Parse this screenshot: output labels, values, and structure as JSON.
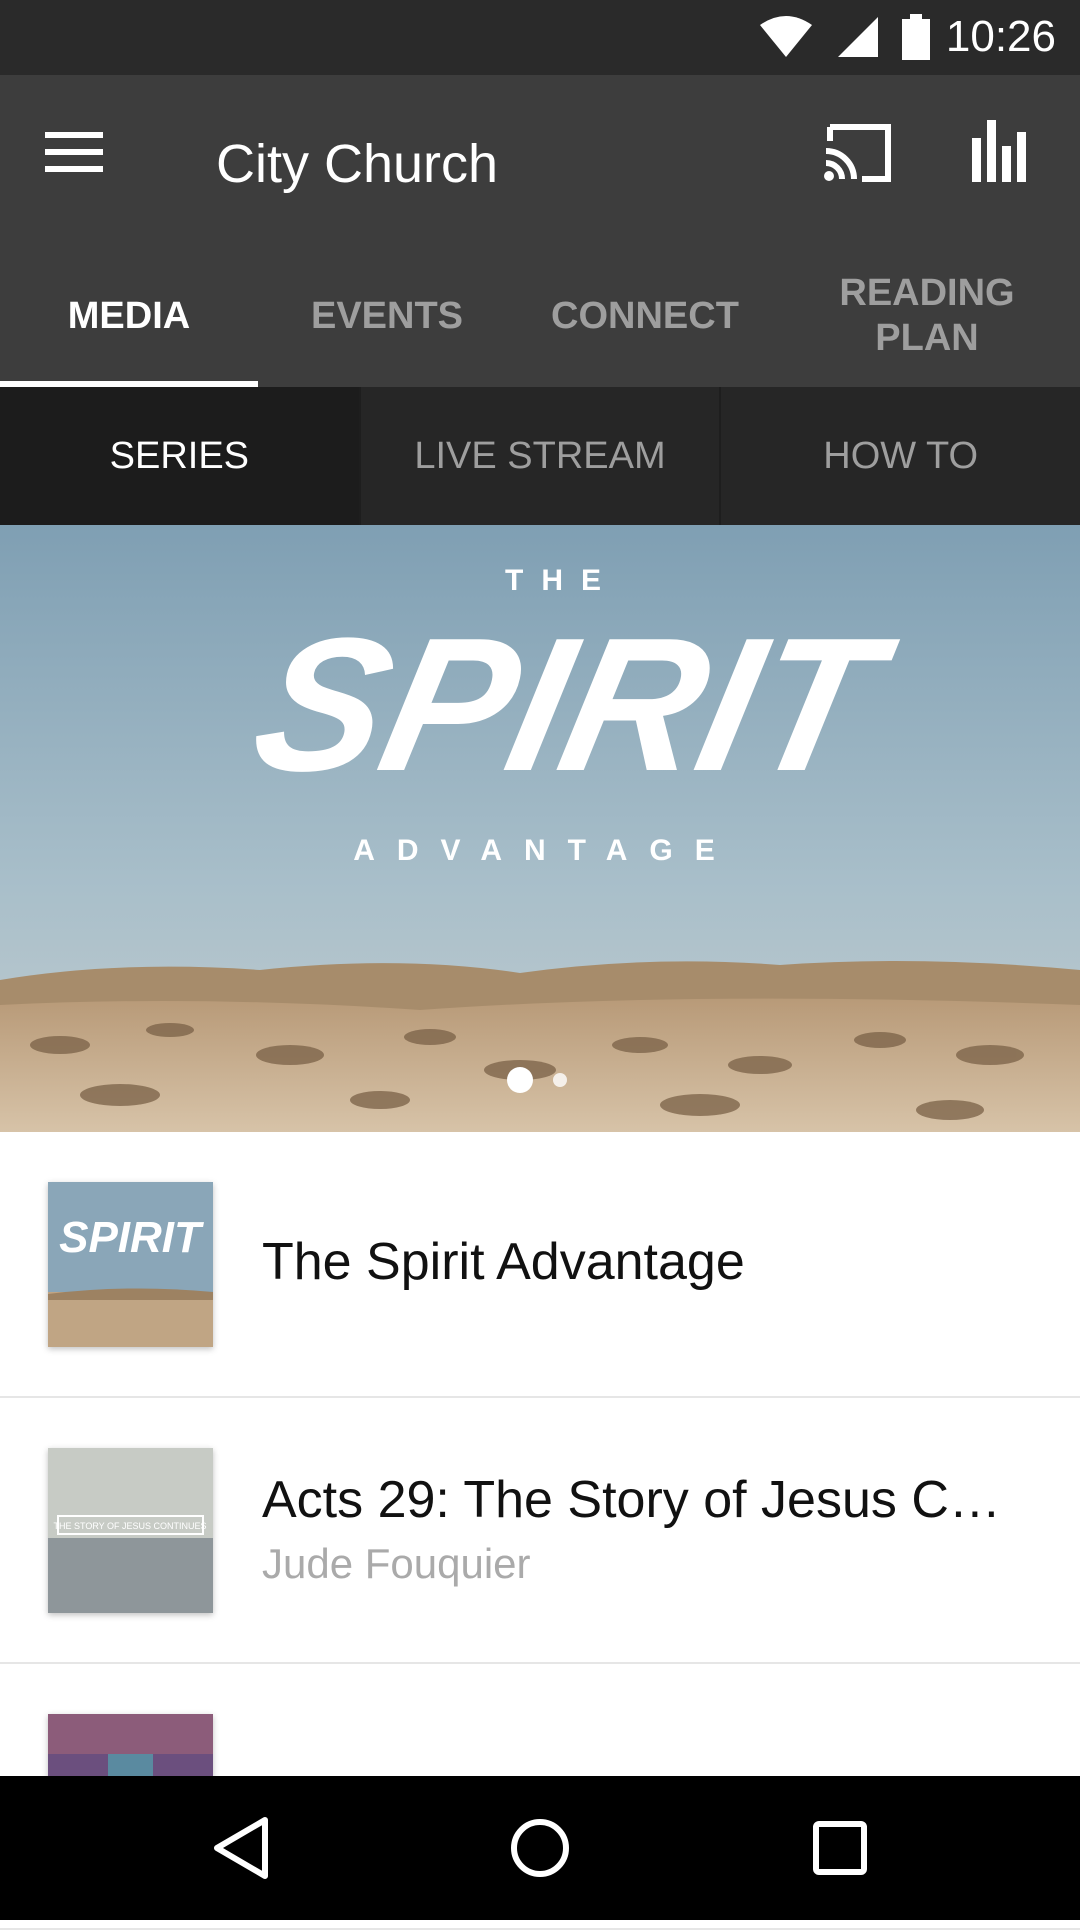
{
  "status": {
    "time": "10:26",
    "icons": [
      "wifi-icon",
      "signal-icon",
      "battery-icon"
    ]
  },
  "appbar": {
    "title": "City Church",
    "icons": [
      "menu-icon",
      "cast-icon",
      "stats-icon"
    ]
  },
  "tabs": [
    {
      "label": "MEDIA",
      "active": true
    },
    {
      "label": "EVENTS",
      "active": false
    },
    {
      "label": "CONNECT",
      "active": false
    },
    {
      "label": "READING PLAN",
      "active": false
    }
  ],
  "subtabs": [
    {
      "label": "SERIES",
      "active": true
    },
    {
      "label": "LIVE STREAM",
      "active": false
    },
    {
      "label": "HOW TO",
      "active": false
    }
  ],
  "hero": {
    "title_top": "THE",
    "title_main": "SPIRIT",
    "title_bottom": "ADVANTAGE",
    "page_indicator": {
      "count": 2,
      "active": 0
    }
  },
  "list": [
    {
      "title": "The Spirit Advantage",
      "subtitle": "",
      "thumb_text": "SPIRIT"
    },
    {
      "title": "Acts 29: The Story of Jesus C…",
      "subtitle": "Jude Fouquier",
      "thumb_text": "THE STORY OF JESUS CONTINUES"
    }
  ],
  "colors": {
    "toolbar": "#3d3d3d",
    "subtabs": "#262626",
    "statusbar": "#2a2a2a",
    "navbar": "#000000",
    "accent": "#ffffff"
  },
  "navbar": {
    "icons": [
      "back-icon",
      "home-icon",
      "recents-icon"
    ]
  }
}
